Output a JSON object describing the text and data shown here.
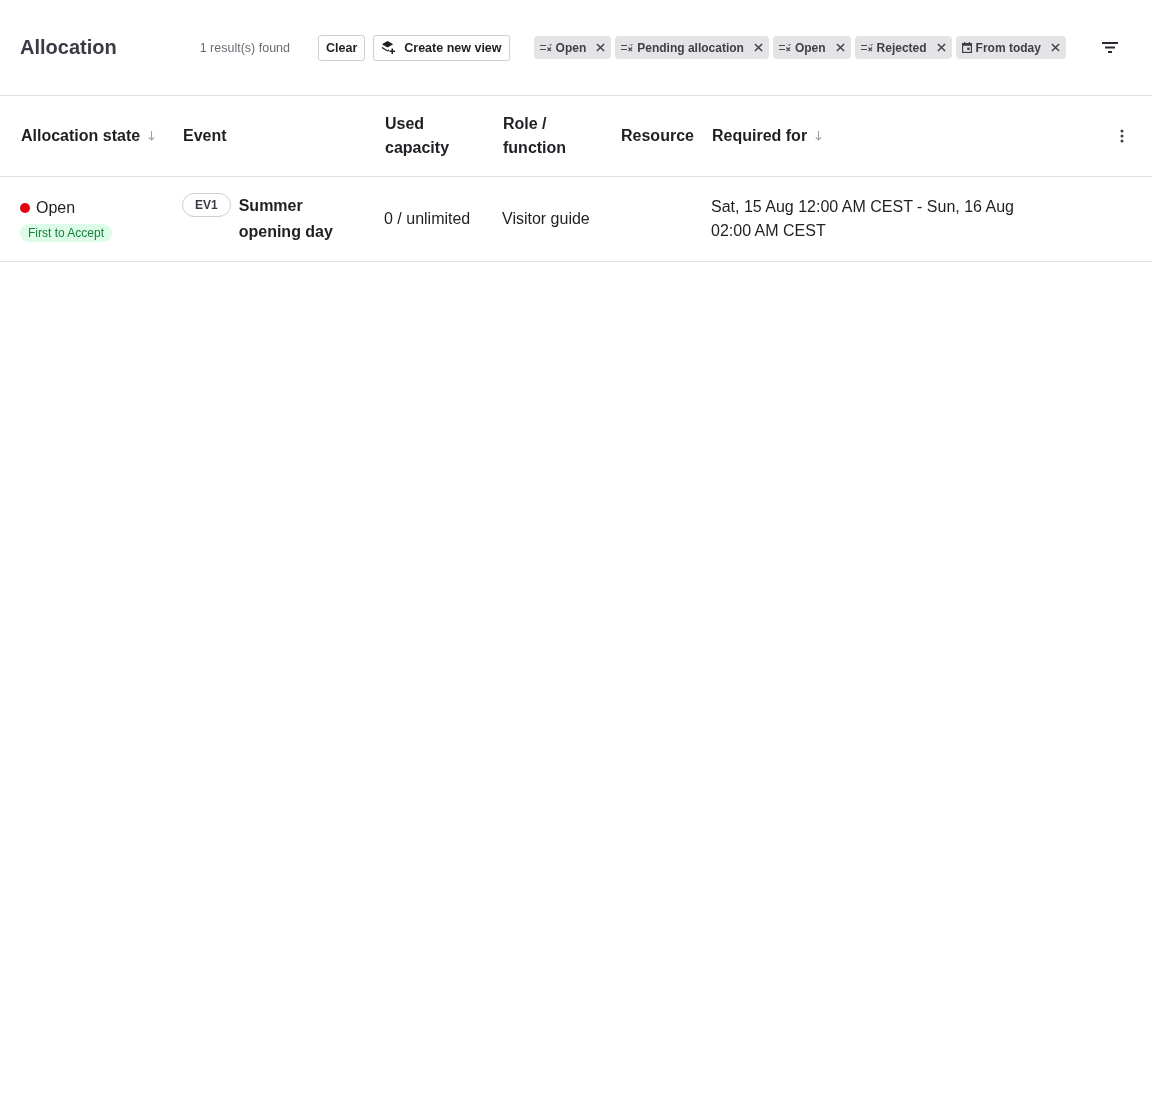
{
  "header": {
    "title": "Allocation",
    "result_count": "1 result(s) found",
    "buttons": [
      {
        "kind": "clear",
        "label": "Clear"
      },
      {
        "kind": "create_view",
        "label": "Create new view"
      }
    ]
  },
  "filters": [
    {
      "kind": "status",
      "label": "Open"
    },
    {
      "kind": "status",
      "label": "Pending allocation"
    },
    {
      "kind": "status",
      "label": "Open"
    },
    {
      "kind": "status",
      "label": "Rejected"
    },
    {
      "kind": "date",
      "label": "From today"
    }
  ],
  "table": {
    "columns": [
      {
        "label": "Allocation state",
        "sort_indicator": true
      },
      {
        "label": "Event",
        "sort_indicator": false
      },
      {
        "label": "Used capacity",
        "sort_indicator": false
      },
      {
        "label": "Role / function",
        "sort_indicator": false
      },
      {
        "label": "Resource",
        "sort_indicator": false
      },
      {
        "label": "Required for",
        "sort_indicator": true
      }
    ],
    "rows": [
      {
        "state": {
          "label": "Open",
          "color": "#e5000f"
        },
        "mode": "First to Accept",
        "event": {
          "code": "EV1",
          "name": "Summer opening day"
        },
        "used_capacity": "0 / unlimited",
        "role": "Visitor guide",
        "required_for": "Sat, 15 Aug 12:00 AM CEST - Sun, 16 Aug 02:00 AM CEST"
      }
    ]
  }
}
